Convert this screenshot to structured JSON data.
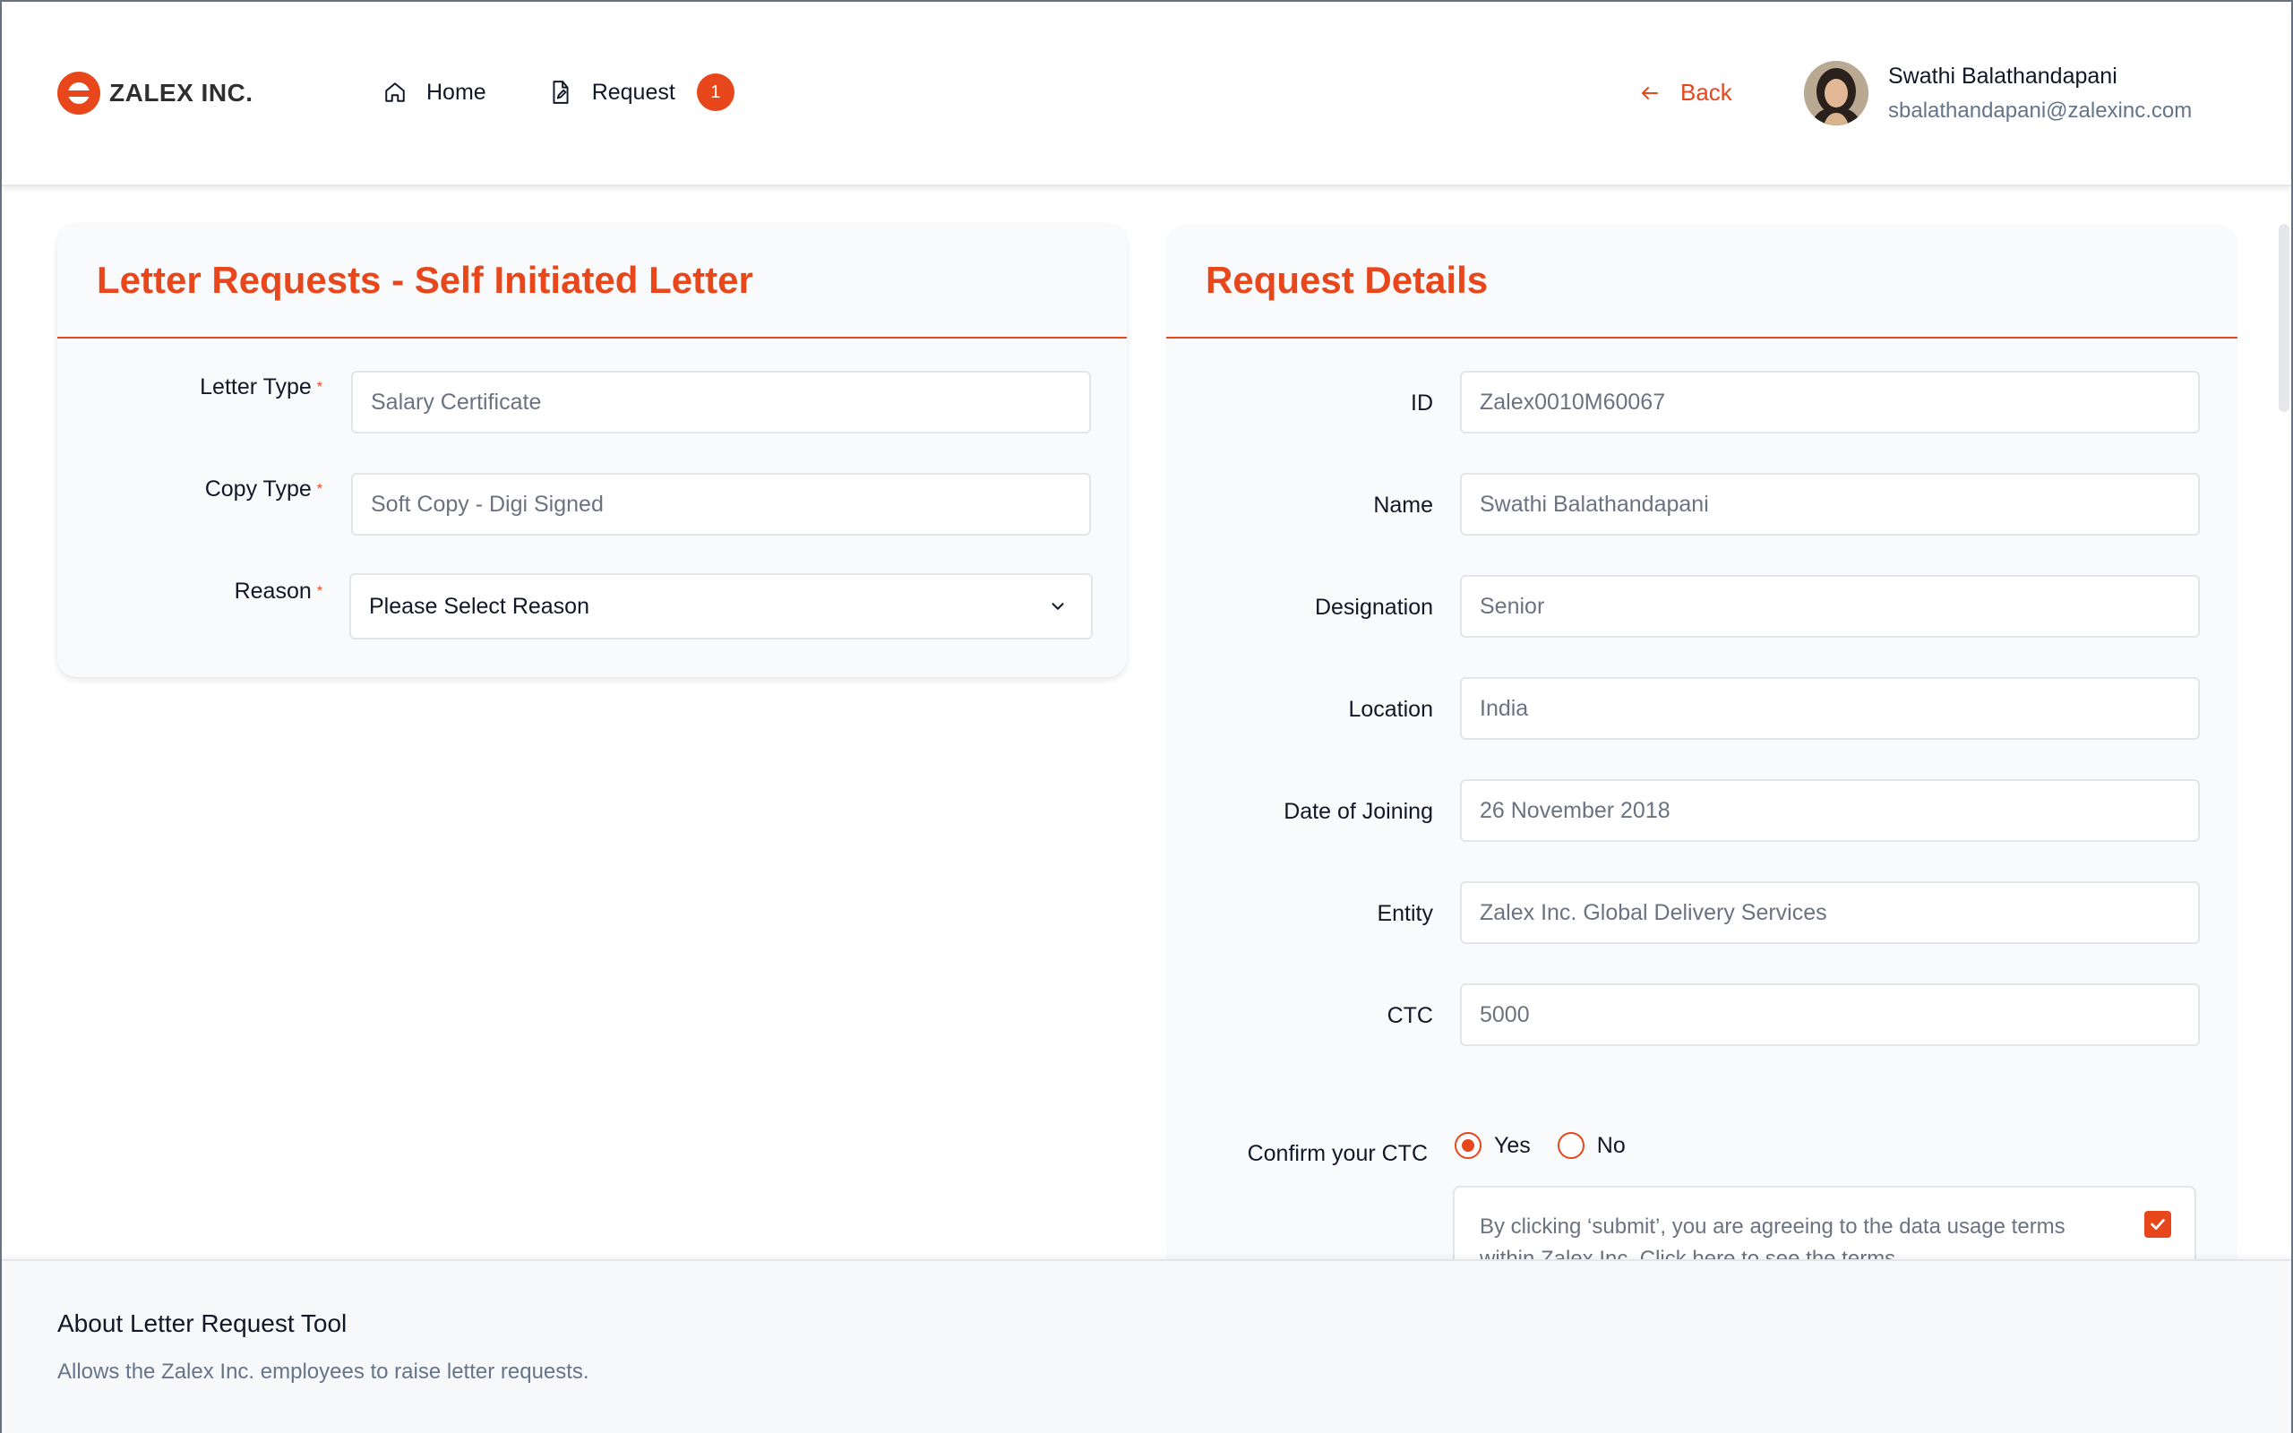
{
  "brand": {
    "name": "ZALEX INC.",
    "accent_color": "#e8461b"
  },
  "nav": {
    "home_label": "Home",
    "request_label": "Request",
    "request_badge": "1"
  },
  "header": {
    "back_label": "Back",
    "user_name": "Swathi Balathandapani",
    "user_email": "sbalathandapani@zalexinc.com"
  },
  "letter_form": {
    "title": "Letter Requests - Self Initiated Letter",
    "letter_type_label": "Letter Type",
    "letter_type_value": "Salary Certificate",
    "copy_type_label": "Copy Type",
    "copy_type_value": "Soft Copy - Digi Signed",
    "reason_label": "Reason",
    "reason_value": "Please Select Reason",
    "required_mark": "*"
  },
  "details": {
    "title": "Request Details",
    "fields": [
      {
        "label": "ID",
        "value": "Zalex0010M60067"
      },
      {
        "label": "Name",
        "value": "Swathi Balathandapani"
      },
      {
        "label": "Designation",
        "value": "Senior"
      },
      {
        "label": "Location",
        "value": "India"
      },
      {
        "label": "Date of Joining",
        "value": "26 November 2018"
      },
      {
        "label": "Entity",
        "value": "Zalex Inc. Global Delivery Services"
      },
      {
        "label": "CTC",
        "value": "5000"
      }
    ],
    "confirm_label": "Confirm your CTC",
    "confirm_options": [
      "Yes",
      "No"
    ],
    "confirm_selected": "Yes",
    "terms_text": "By clicking ‘submit’, you are agreeing to the data usage terms within Zalex Inc. Click here to see the terms.",
    "terms_checked": true
  },
  "footer": {
    "title": "About Letter Request Tool",
    "description": "Allows the Zalex Inc. employees to raise letter requests."
  }
}
